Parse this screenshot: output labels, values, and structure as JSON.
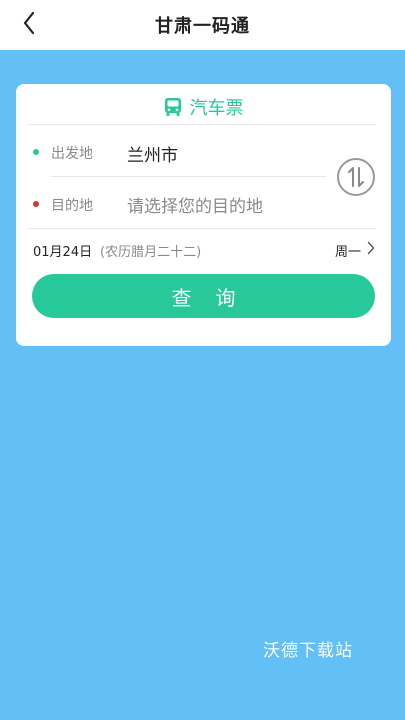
{
  "header": {
    "title": "甘肃一码通"
  },
  "ticket": {
    "tab_label": "汽车票"
  },
  "route": {
    "origin_label": "出发地",
    "origin_value": "兰州市",
    "destination_label": "目的地",
    "destination_placeholder": "请选择您的目的地"
  },
  "date": {
    "date": "01月24日",
    "lunar": "(农历腊月二十二)",
    "weekday": "周一"
  },
  "actions": {
    "search_label": "查询"
  },
  "watermark": {
    "text": "沃德下载站"
  },
  "colors": {
    "accent": "#27c99a",
    "background": "#62c0f7",
    "origin_dot": "#27c99a",
    "destination_dot": "#d9362b"
  }
}
